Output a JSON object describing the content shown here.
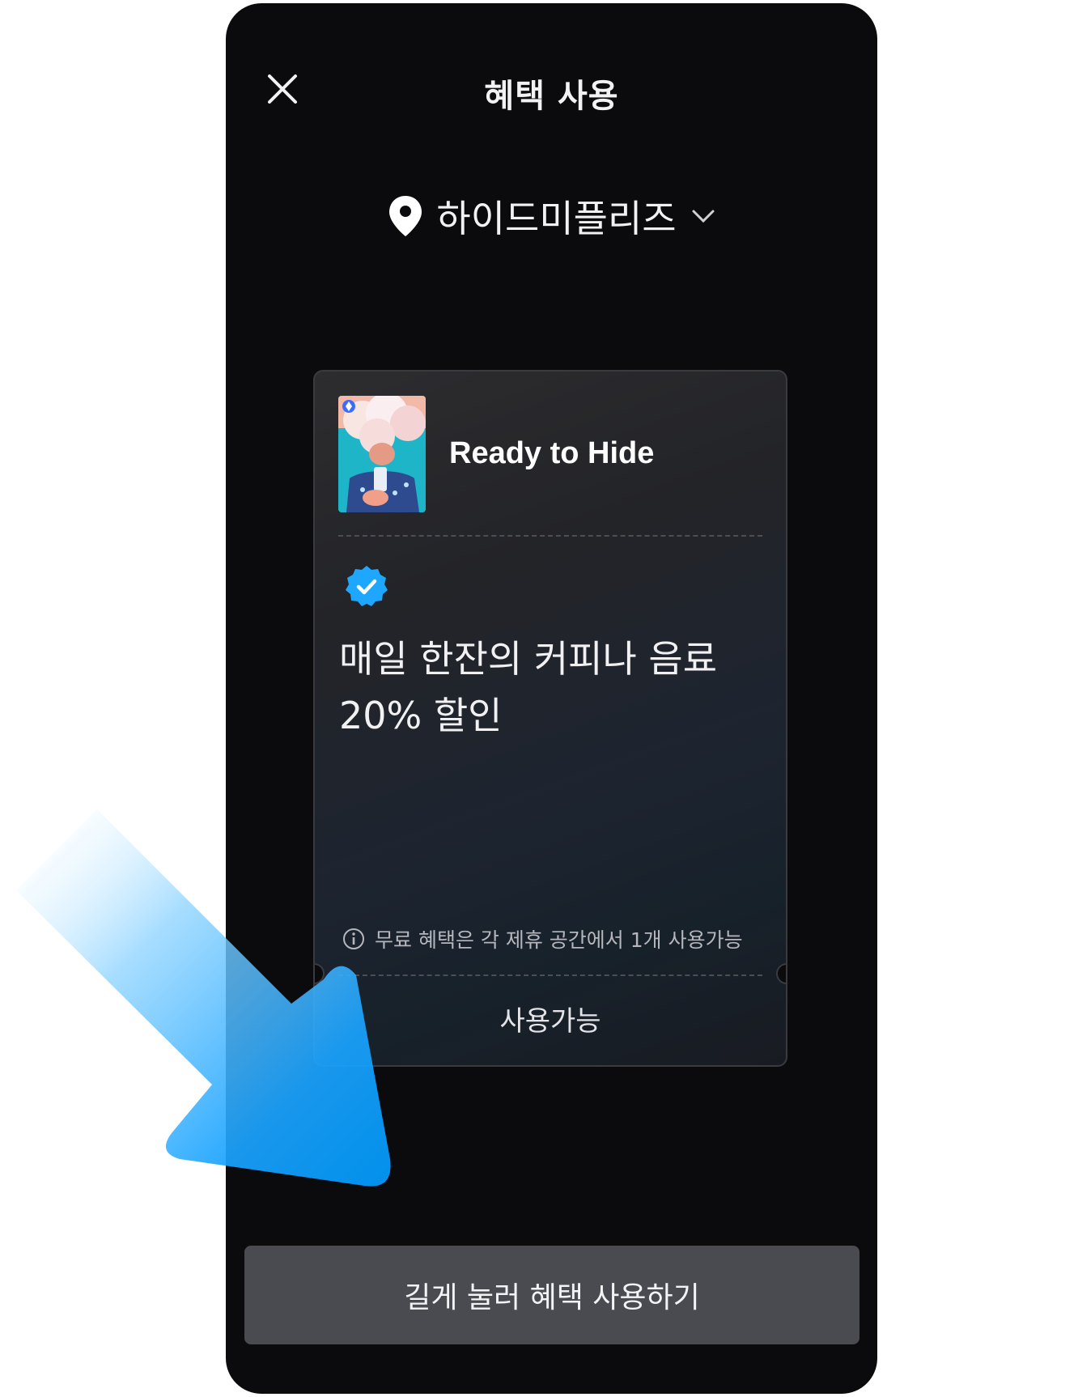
{
  "header": {
    "title": "혜택 사용",
    "close_icon": "close-icon"
  },
  "location": {
    "name": "하이드미플리즈",
    "pin_icon": "map-pin-icon",
    "dropdown_icon": "chevron-down-icon"
  },
  "card": {
    "nft_name": "Ready to Hide",
    "verified_icon": "verified-badge-icon",
    "benefit_line1": "매일 한잔의 커피나 음료",
    "benefit_line2": "20% 할인",
    "notice": "무료 혜택은 각 제휴 공간에서 1개 사용가능",
    "status": "사용가능"
  },
  "action": {
    "label": "길게 눌러 혜택 사용하기"
  },
  "colors": {
    "background": "#0b0b0e",
    "accent": "#1ea7ff",
    "button": "#4a4b51"
  }
}
